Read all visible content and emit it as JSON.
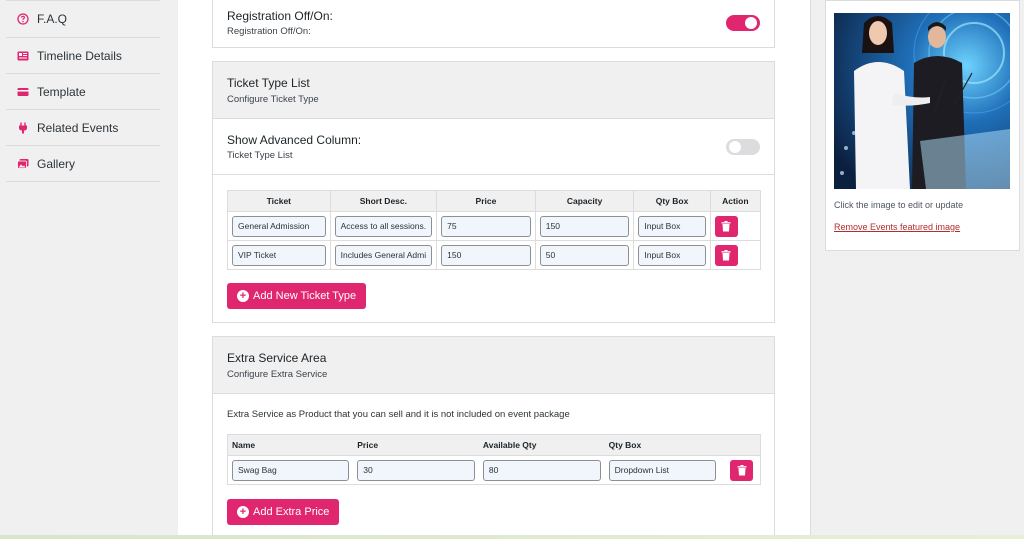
{
  "sidebar": {
    "items": [
      {
        "label": "F.A.Q",
        "icon": "question-circle-icon"
      },
      {
        "label": "Timeline Details",
        "icon": "timeline-icon"
      },
      {
        "label": "Template",
        "icon": "template-icon"
      },
      {
        "label": "Related Events",
        "icon": "plug-icon"
      },
      {
        "label": "Gallery",
        "icon": "gallery-icon"
      }
    ]
  },
  "registration": {
    "title": "Registration Off/On:",
    "subtitle": "Registration Off/On:",
    "enabled": true
  },
  "ticket_type": {
    "title": "Ticket Type List",
    "subtitle": "Configure Ticket Type",
    "advanced_title": "Show Advanced Column:",
    "advanced_subtitle": "Ticket Type List",
    "advanced_enabled": false,
    "columns": {
      "ticket": "Ticket",
      "short_desc": "Short Desc.",
      "price": "Price",
      "capacity": "Capacity",
      "qty_box": "Qty Box",
      "action": "Action"
    },
    "rows": [
      {
        "ticket": "General Admission",
        "short_desc": "Access to all sessions.",
        "price": "75",
        "capacity": "150",
        "qty_box": "Input Box"
      },
      {
        "ticket": "VIP Ticket",
        "short_desc": "Includes General Admi",
        "price": "150",
        "capacity": "50",
        "qty_box": "Input Box"
      }
    ],
    "add_label": "Add New Ticket Type"
  },
  "extra_service": {
    "title": "Extra Service Area",
    "subtitle": "Configure Extra Service",
    "description": "Extra Service as Product that you can sell and it is not included on event package",
    "columns": {
      "name": "Name",
      "price": "Price",
      "available_qty": "Available Qty",
      "qty_box": "Qty Box"
    },
    "rows": [
      {
        "name": "Swag Bag",
        "price": "30",
        "available_qty": "80",
        "qty_box": "Dropdown List"
      }
    ],
    "add_label": "Add Extra Price"
  },
  "featured_image": {
    "note": "Click the image to edit or update",
    "remove_label": "Remove Events featured image"
  },
  "colors": {
    "accent": "#e0266e",
    "panel_head": "#f0f0f1",
    "link_red": "#b32d2e"
  }
}
